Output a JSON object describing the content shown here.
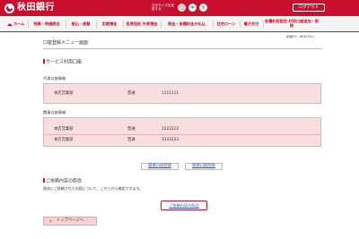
{
  "header": {
    "bank_name": "秋田銀行",
    "font_size_label": "文字サイズを変更する",
    "font_sizes": [
      "小",
      "中",
      "大"
    ],
    "logout_label": "ログアウト"
  },
  "nav": {
    "items": [
      "ホーム",
      "残高・明細照会",
      "振込・振替",
      "定期預金",
      "投資信託 外貨預金",
      "税金・各種料金の払込",
      "住宅ローン",
      "電子交付",
      "各種利用設定 利用口座追加・削除"
    ]
  },
  "page": {
    "screen_id": "画面ID：BRKC001",
    "title": "口座登録メニュー画面",
    "services_heading": "サービス利用口座",
    "representative_label": "代表口座情報",
    "representative_account": {
      "branch": "本店営業部",
      "type": "普通",
      "number": "1111111"
    },
    "related_label": "関連口座情報",
    "related_accounts": [
      {
        "branch": "本店営業部",
        "type": "普通",
        "number": "2222222"
      },
      {
        "branch": "本店営業部",
        "type": "普通",
        "number": "3333333"
      }
    ],
    "register_button": "関連口座登録",
    "delete_button": "関連口座削除",
    "inquiry_heading": "ご依頼内容の照会",
    "inquiry_desc": "過去にご依頼された内容について、こちらから確認できます。",
    "inquiry_button": "ご依頼内容の照会",
    "top_button": "トップページへ"
  }
}
